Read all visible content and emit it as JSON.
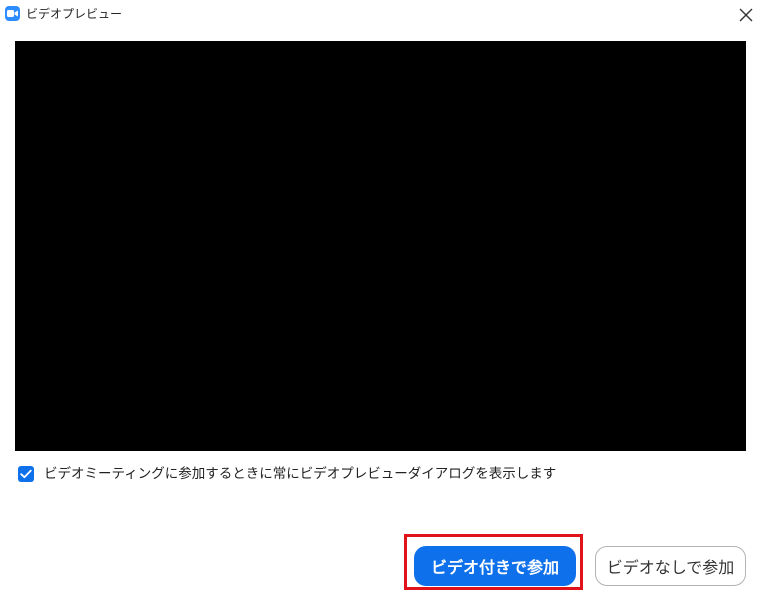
{
  "window": {
    "title": "ビデオプレビュー",
    "app_icon": "zoom-video-icon",
    "close_icon": "close-icon"
  },
  "preview": {
    "state": "no-video-signal"
  },
  "options": {
    "always_show_preview_label": "ビデオミーティングに参加するときに常にビデオプレビューダイアログを表示します",
    "always_show_preview_checked": true
  },
  "actions": {
    "join_with_video_label": "ビデオ付きで参加",
    "join_without_video_label": "ビデオなしで参加",
    "highlighted": "join_with_video"
  },
  "colors": {
    "primary": "#0e71eb",
    "highlight": "#e0121a",
    "preview_bg": "#000000",
    "app_icon": "#2d8cff"
  }
}
